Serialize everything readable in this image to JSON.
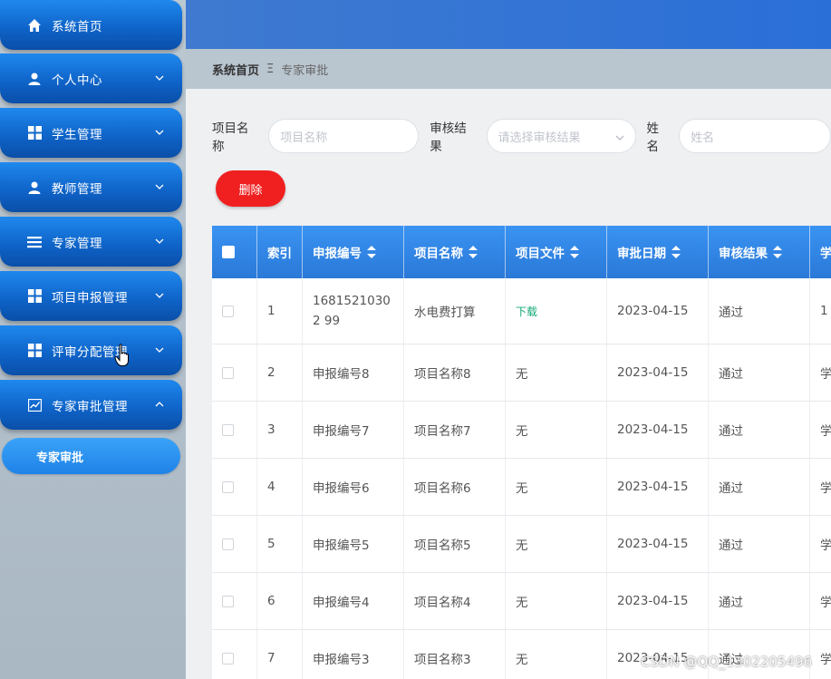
{
  "sidebar": {
    "items": [
      {
        "label": "系统首页",
        "icon": "home-icon"
      },
      {
        "label": "个人中心",
        "icon": "user-icon"
      },
      {
        "label": "学生管理",
        "icon": "grid-icon"
      },
      {
        "label": "教师管理",
        "icon": "user-icon"
      },
      {
        "label": "专家管理",
        "icon": "list-icon"
      },
      {
        "label": "项目申报管理",
        "icon": "grid-icon"
      },
      {
        "label": "评审分配管理",
        "icon": "grid-icon"
      },
      {
        "label": "专家审批管理",
        "icon": "chart-icon"
      }
    ],
    "active_sub": "专家审批"
  },
  "breadcrumb": {
    "home": "系统首页",
    "separator": "Ξ",
    "current": "专家审批"
  },
  "search": {
    "project_name_label": "项目名称",
    "project_name_placeholder": "项目名称",
    "review_result_label": "审核结果",
    "review_result_placeholder": "请选择审核结果",
    "name_label": "姓名",
    "name_placeholder": "姓名"
  },
  "actions": {
    "delete_label": "删除"
  },
  "table": {
    "headers": [
      "索引",
      "申报编号",
      "项目名称",
      "项目文件",
      "审批日期",
      "审核结果",
      "学"
    ],
    "rows": [
      {
        "idx": "1",
        "code": "16815210302 99",
        "name": "水电费打算",
        "file": "下载",
        "date": "2023-04-15",
        "result": "通过",
        "extra": "1"
      },
      {
        "idx": "2",
        "code": "申报编号8",
        "name": "项目名称8",
        "file": "无",
        "date": "2023-04-15",
        "result": "通过",
        "extra": "学"
      },
      {
        "idx": "3",
        "code": "申报编号7",
        "name": "项目名称7",
        "file": "无",
        "date": "2023-04-15",
        "result": "通过",
        "extra": "学"
      },
      {
        "idx": "4",
        "code": "申报编号6",
        "name": "项目名称6",
        "file": "无",
        "date": "2023-04-15",
        "result": "通过",
        "extra": "学"
      },
      {
        "idx": "5",
        "code": "申报编号5",
        "name": "项目名称5",
        "file": "无",
        "date": "2023-04-15",
        "result": "通过",
        "extra": "学"
      },
      {
        "idx": "6",
        "code": "申报编号4",
        "name": "项目名称4",
        "file": "无",
        "date": "2023-04-15",
        "result": "通过",
        "extra": "学"
      },
      {
        "idx": "7",
        "code": "申报编号3",
        "name": "项目名称3",
        "file": "无",
        "date": "2023-04-15",
        "result": "通过",
        "extra": "学"
      }
    ]
  },
  "watermark": "CSDN @QQ_1302205496",
  "colors": {
    "accent": "#2a79d8",
    "danger": "#f02020",
    "link": "#13a877"
  }
}
